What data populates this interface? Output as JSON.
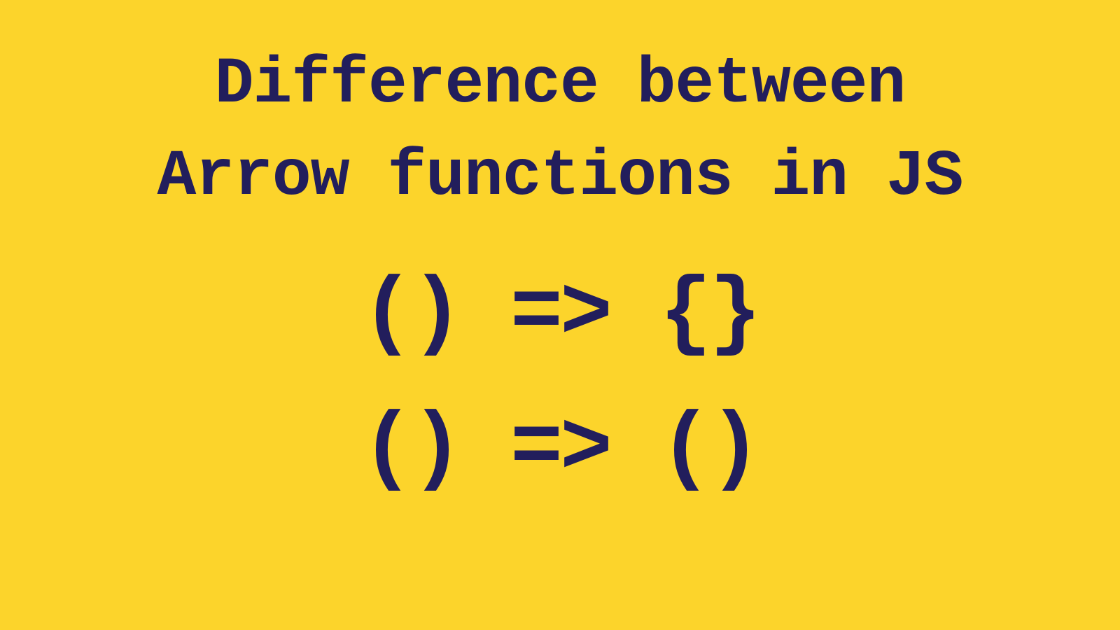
{
  "title": {
    "line1": "Difference between",
    "line2": "Arrow functions in JS"
  },
  "code": {
    "example1": "() => {}",
    "example2": "() => ()"
  },
  "colors": {
    "background": "#FCD42B",
    "text": "#221E5C"
  }
}
